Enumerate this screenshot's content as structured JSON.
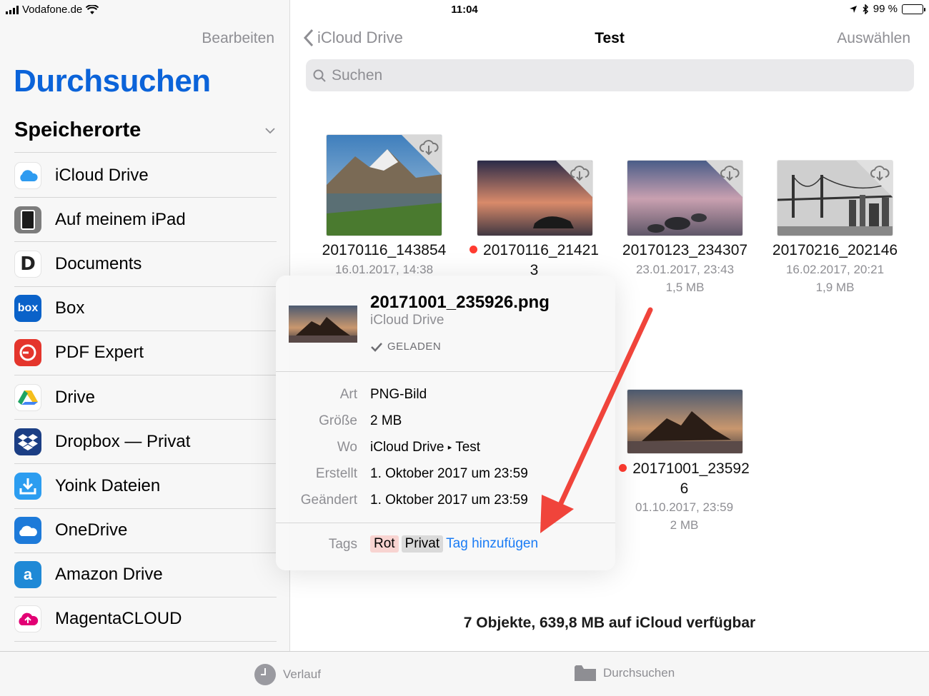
{
  "status_bar": {
    "carrier": "Vodafone.de",
    "time": "11:04",
    "battery": "99 %"
  },
  "sidebar": {
    "edit_label": "Bearbeiten",
    "title": "Durchsuchen",
    "section_title": "Speicherorte",
    "items": [
      {
        "label": "iCloud Drive",
        "icon": "icloud-icon"
      },
      {
        "label": "Auf meinem iPad",
        "icon": "ipad-icon"
      },
      {
        "label": "Documents",
        "icon": "documents-app-icon"
      },
      {
        "label": "Box",
        "icon": "box-app-icon"
      },
      {
        "label": "PDF Expert",
        "icon": "pdf-expert-icon"
      },
      {
        "label": "Drive",
        "icon": "google-drive-icon"
      },
      {
        "label": "Dropbox — Privat",
        "icon": "dropbox-icon"
      },
      {
        "label": "Yoink Dateien",
        "icon": "yoink-icon"
      },
      {
        "label": "OneDrive",
        "icon": "onedrive-icon"
      },
      {
        "label": "Amazon Drive",
        "icon": "amazon-drive-icon"
      },
      {
        "label": "MagentaCLOUD",
        "icon": "magentacloud-icon"
      }
    ]
  },
  "nav": {
    "back_label": "iCloud Drive",
    "title": "Test",
    "select_label": "Auswählen"
  },
  "search": {
    "placeholder": "Suchen"
  },
  "files": [
    {
      "name": "20170116_143854",
      "date": "16.01.2017, 14:38",
      "tag_color": "",
      "cloud": true
    },
    {
      "name": "20170116_21421",
      "name_line2": "3",
      "tag_color": "#ff3b30",
      "cloud": true
    },
    {
      "name": "20170123_234307",
      "date": "23.01.2017, 23:43",
      "size": "1,5 MB",
      "cloud": true
    },
    {
      "name": "20170216_202146",
      "date": "16.02.2017, 20:21",
      "size": "1,9 MB",
      "cloud": true
    },
    {
      "name": "20171001_23592",
      "name_line2": "6",
      "date": "01.10.2017, 23:59",
      "size": "2 MB",
      "tag_color": "#ff3b30",
      "cloud": false
    }
  ],
  "popover": {
    "file_name": "20171001_235926.png",
    "location": "iCloud Drive",
    "status": "GELADEN",
    "rows": [
      {
        "key": "Art",
        "value": "PNG-Bild"
      },
      {
        "key": "Größe",
        "value": "2 MB"
      },
      {
        "key": "Wo",
        "value_a": "iCloud Drive",
        "value_b": "Test"
      },
      {
        "key": "Erstellt",
        "value": "1. Oktober 2017 um 23:59"
      },
      {
        "key": "Geändert",
        "value": "1. Oktober 2017 um 23:59"
      }
    ],
    "tags_label": "Tags",
    "tags": [
      {
        "label": "Rot",
        "bg": "#f8d4d1"
      },
      {
        "label": "Privat",
        "bg": "#dadada"
      }
    ],
    "add_tag_label": "Tag hinzufügen"
  },
  "footer": {
    "message": "7 Objekte, 639,8 MB auf iCloud verfügbar"
  },
  "tabbar": {
    "recent_label": "Verlauf",
    "browse_label": "Durchsuchen"
  },
  "colors": {
    "accent": "#0b63d9",
    "link": "#1a7cf5",
    "annotation_arrow": "#f0443b"
  }
}
